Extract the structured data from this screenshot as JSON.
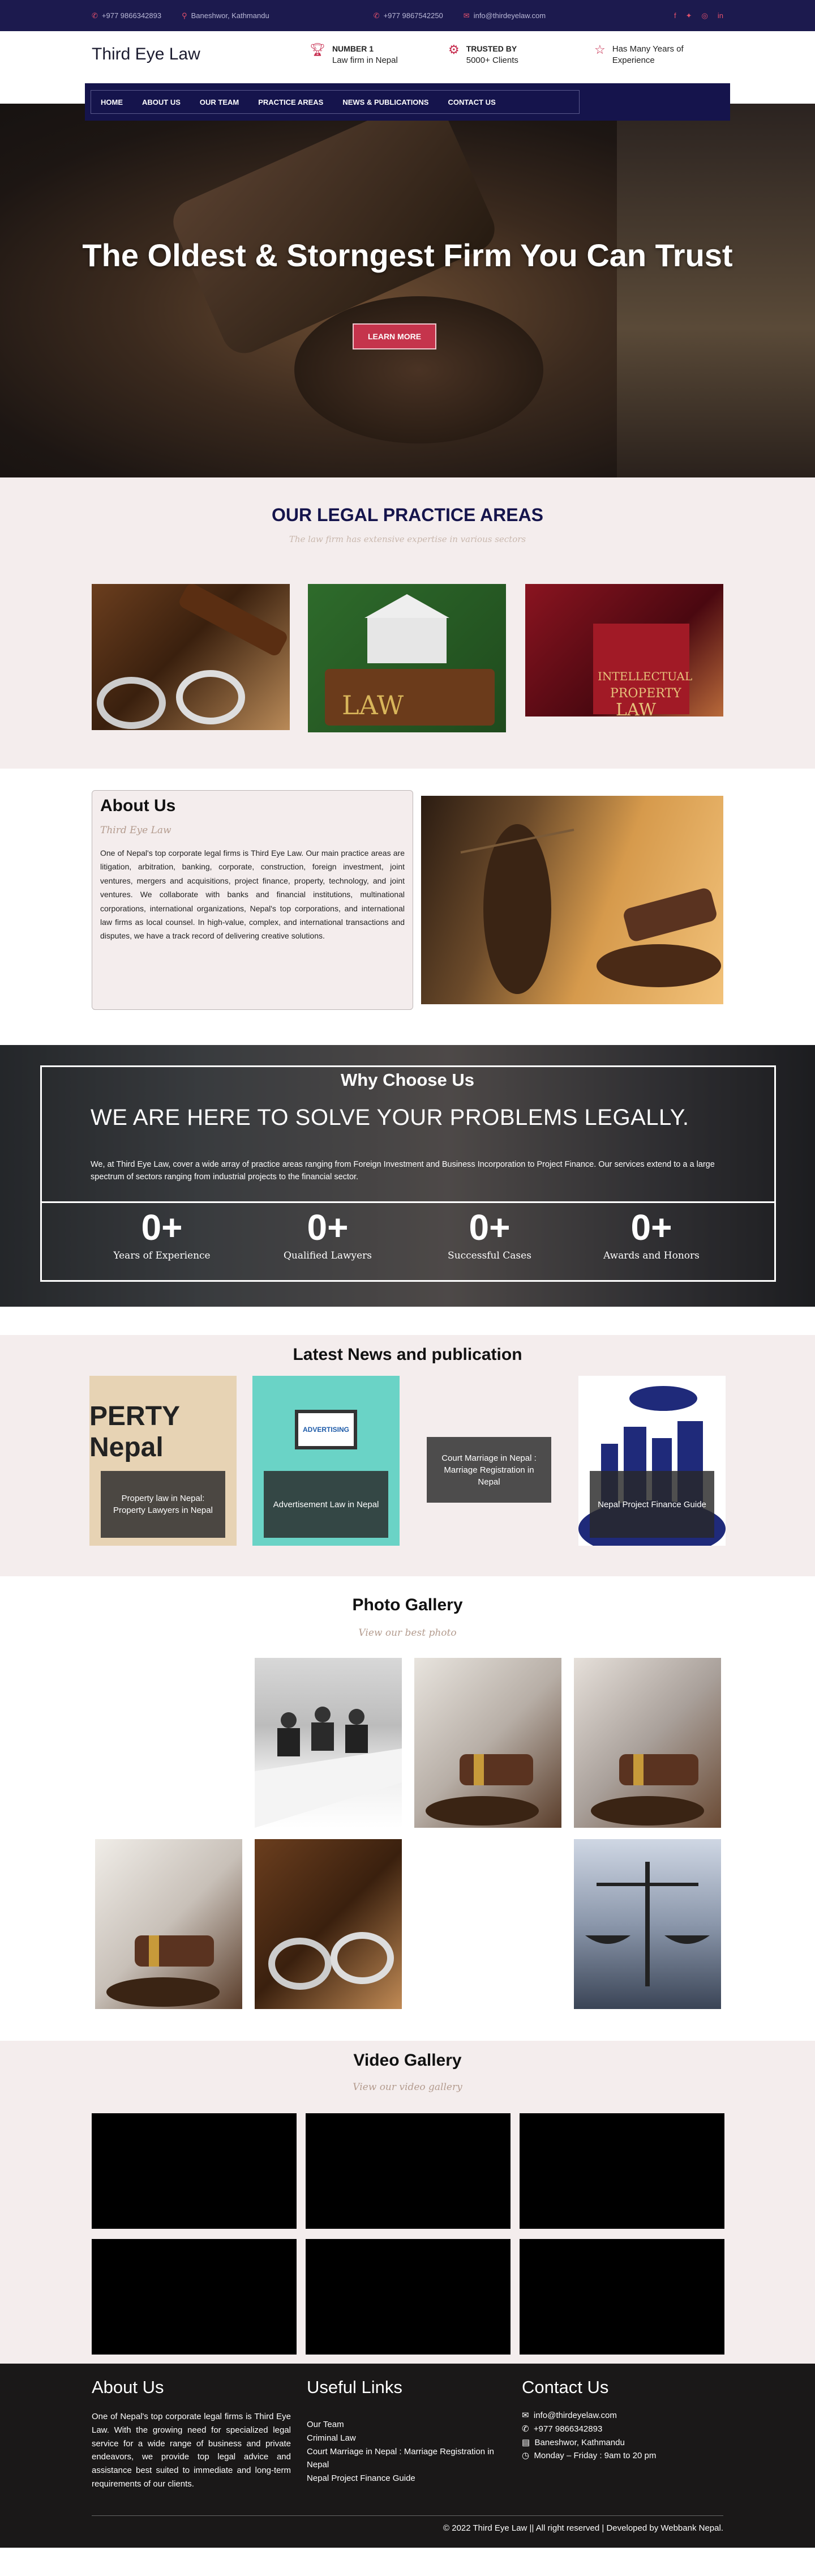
{
  "topbar": {
    "items": [
      {
        "icon": "phone-icon",
        "text": "+977 9866342893"
      },
      {
        "icon": "location-icon",
        "text": "Baneshwor, Kathmandu"
      },
      {
        "icon": "phone-icon",
        "text": "+977 9867542250"
      },
      {
        "icon": "mail-icon",
        "text": "info@thirdeyelaw.com"
      }
    ],
    "social": [
      "facebook-icon",
      "twitter-icon",
      "instagram-icon",
      "linkedin-icon"
    ]
  },
  "header": {
    "logo": "Third Eye Law",
    "info": [
      {
        "icon": "trophy-icon",
        "title": "NUMBER 1",
        "text": "Law firm in Nepal"
      },
      {
        "icon": "award-icon",
        "title": "TRUSTED BY",
        "text": "5000+ Clients"
      },
      {
        "icon": "star-icon",
        "title": "Has Many Years of",
        "text": "Experience"
      }
    ]
  },
  "nav": [
    "HOME",
    "ABOUT US",
    "OUR TEAM",
    "PRACTICE AREAS",
    "NEWS & PUBLICATIONS",
    "CONTACT US"
  ],
  "hero": {
    "title": "The Oldest & Storngest Firm You Can Trust",
    "button": "LEARN MORE"
  },
  "practice": {
    "title": "OUR LEGAL PRACTICE AREAS",
    "subtitle": "The law firm has extensive expertise in various sectors"
  },
  "about": {
    "title": "About Us",
    "signature": "Third Eye Law",
    "text": "One of Nepal's top corporate legal firms is Third Eye Law. Our main practice areas are litigation, arbitration, banking, corporate, construction, foreign investment, joint ventures, mergers and acquisitions, project finance, property, technology, and joint ventures. We collaborate with banks and financial institutions, multinational corporations, international organizations, Nepal's top corporations, and international law firms as local counsel. In high-value, complex, and international transactions and disputes, we have a track record of delivering creative solutions."
  },
  "why": {
    "title": "Why Choose Us",
    "headline": "WE ARE HERE TO SOLVE YOUR PROBLEMS LEGALLY.",
    "text": "We, at Third Eye Law, cover a wide array of practice areas ranging from Foreign Investment and Business Incorporation to Project Finance. Our services extend to a a large spectrum of sectors ranging from industrial projects to the financial sector.",
    "counters": [
      {
        "value": "0+",
        "label": "Years of Experience"
      },
      {
        "value": "0+",
        "label": "Qualified Lawyers"
      },
      {
        "value": "0+",
        "label": "Successful Cases"
      },
      {
        "value": "0+",
        "label": "Awards and Honors"
      }
    ]
  },
  "news": {
    "title": "Latest News and publication",
    "items": [
      {
        "caption": "Property law in Nepal: Property Lawyers in Nepal",
        "image_text": "PERTY Nepal"
      },
      {
        "caption": "Advertisement Law in Nepal",
        "image_text": "ADVERTISING"
      },
      {
        "caption": "Court Marriage in Nepal : Marriage Registration in Nepal"
      },
      {
        "caption": "Nepal Project Finance Guide"
      }
    ]
  },
  "gallery": {
    "title": "Photo Gallery",
    "subtitle": "View our best photo"
  },
  "video": {
    "title": "Video Gallery",
    "subtitle": "View our video gallery"
  },
  "footer": {
    "about_title": "About Us",
    "about_text": "One of Nepal's top corporate legal firms is Third Eye Law. With the growing need for specialized legal service for a wide range of business and private endeavors, we provide top legal advice and assistance best suited to immediate and long-term requirements of our clients.",
    "links_title": "Useful Links",
    "links": [
      "Our Team",
      "Criminal Law",
      "Court Marriage in Nepal : Marriage Registration in Nepal",
      "Nepal Project Finance Guide"
    ],
    "contact_title": "Contact Us",
    "contacts": [
      {
        "icon": "mail-icon",
        "text": "info@thirdeyelaw.com"
      },
      {
        "icon": "phone-icon",
        "text": "+977 9866342893"
      },
      {
        "icon": "map-icon",
        "text": "Baneshwor, Kathmandu"
      },
      {
        "icon": "clock-icon",
        "text": "Monday – Friday : 9am to 20 pm"
      }
    ],
    "copyright": "© 2022 Third Eye Law || All right reserved | Developed by Webbank Nepal."
  }
}
